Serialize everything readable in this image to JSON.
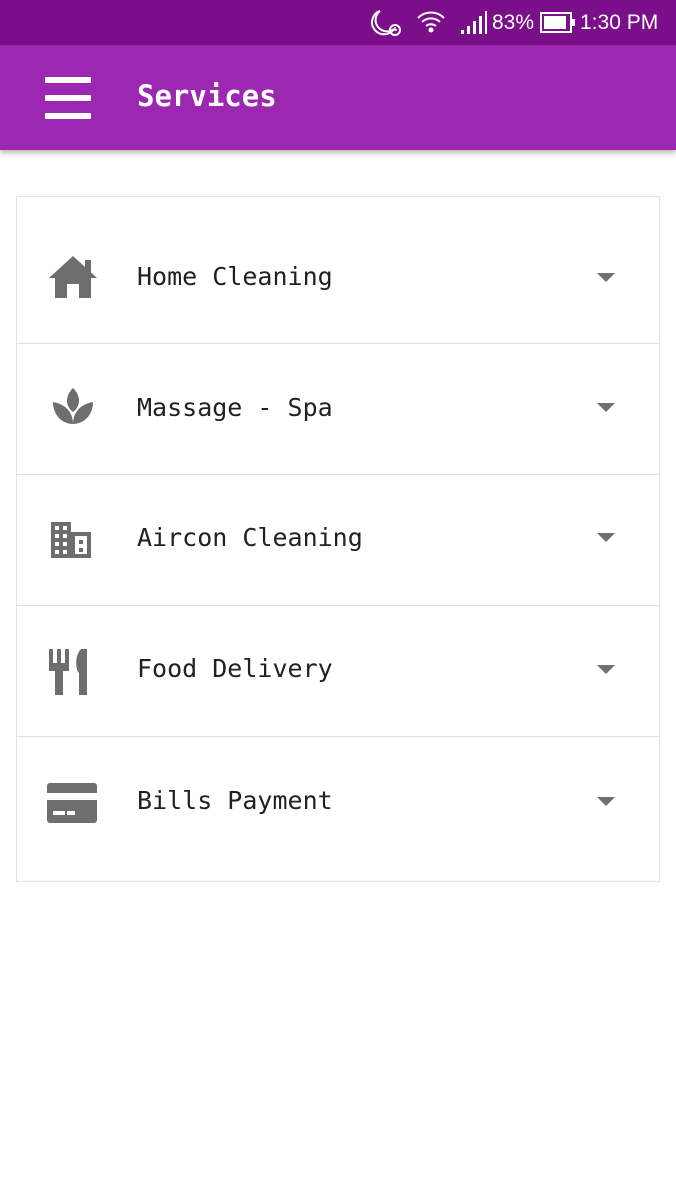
{
  "status_bar": {
    "icons": [
      "moon-alarm-icon",
      "wifi-icon",
      "signal-icon",
      "battery-icon"
    ],
    "battery": "83%",
    "time": "1:30 PM",
    "background": "#7b0f8a"
  },
  "app_bar": {
    "title": "Services",
    "menu_icon": "hamburger-menu-icon",
    "background": "#9c27b0"
  },
  "services": [
    {
      "label": "Home Cleaning",
      "icon": "home-icon"
    },
    {
      "label": "Massage - Spa",
      "icon": "spa-icon"
    },
    {
      "label": "Aircon Cleaning",
      "icon": "building-icon"
    },
    {
      "label": "Food Delivery",
      "icon": "restaurant-icon"
    },
    {
      "label": "Bills Payment",
      "icon": "credit-card-icon"
    }
  ],
  "colors": {
    "icon": "#6e6e6e",
    "text": "#212121",
    "divider": "#e0e0e0"
  }
}
